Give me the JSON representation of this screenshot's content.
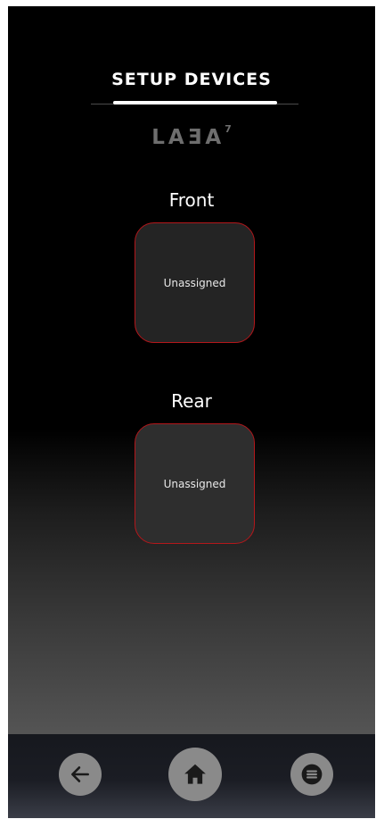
{
  "header": {
    "title": "SETUP DEVICES"
  },
  "logo": {
    "text": "LAƎA",
    "superscript": "7"
  },
  "devices": [
    {
      "label": "Front",
      "status": "Unassigned"
    },
    {
      "label": "Rear",
      "status": "Unassigned"
    }
  ],
  "navigation": {
    "back_icon": "arrow-left-icon",
    "home_icon": "home-icon",
    "menu_icon": "menu-icon"
  },
  "colors": {
    "slot_border": "#b3171b",
    "text": "#ffffff",
    "nav_button": "#8a8a8a"
  }
}
